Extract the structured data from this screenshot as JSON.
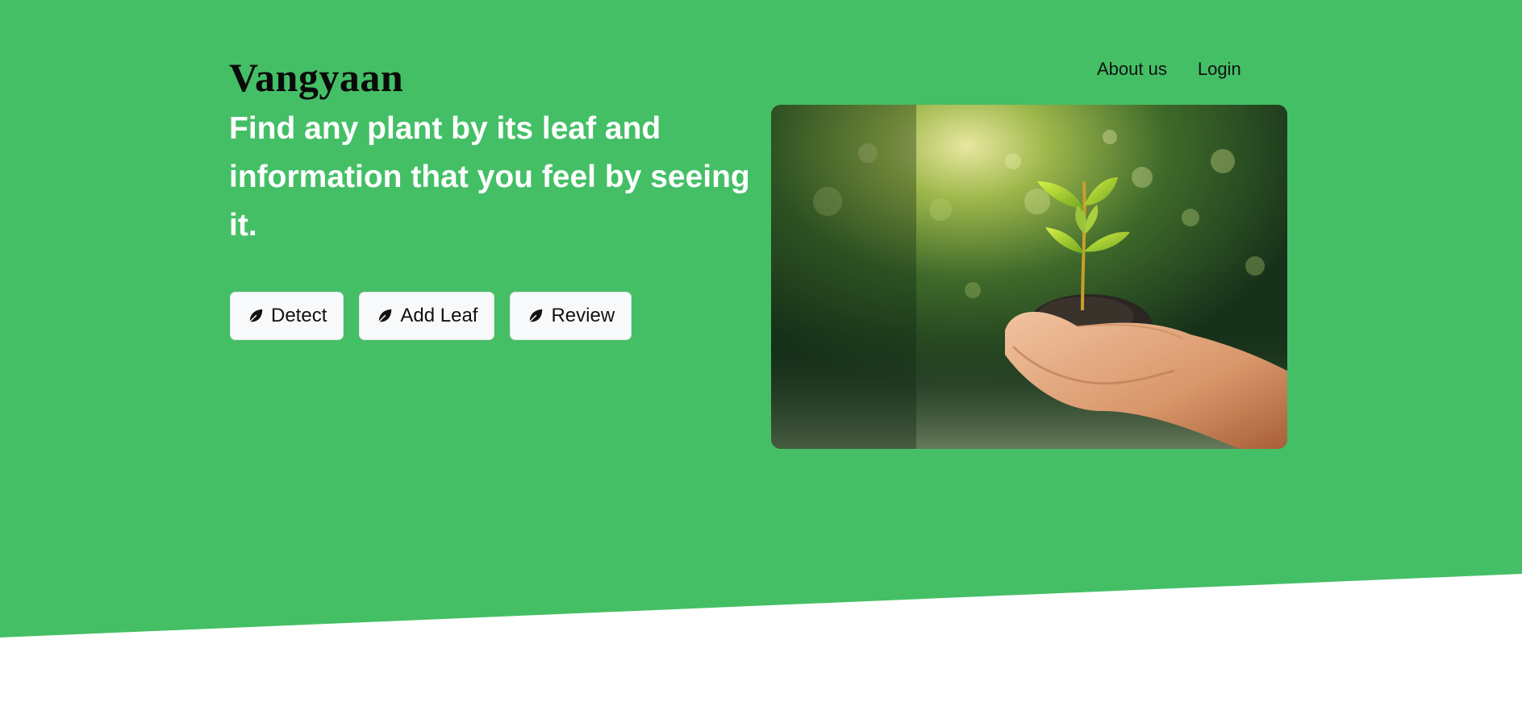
{
  "brand": {
    "name": "Vangyaan"
  },
  "nav": {
    "items": [
      {
        "label": "About us"
      },
      {
        "label": "Login"
      }
    ]
  },
  "hero": {
    "headline": "Find any plant by its leaf and information that you feel by seeing it.",
    "buttons": [
      {
        "label": "Detect",
        "icon": "leaf-icon"
      },
      {
        "label": "Add Leaf",
        "icon": "leaf-icon"
      },
      {
        "label": "Review",
        "icon": "leaf-icon"
      }
    ]
  },
  "colors": {
    "accent": "#44bf66",
    "button_bg": "#f8f9fa",
    "headline": "#ffffff",
    "brand": "#0a0a0a"
  }
}
